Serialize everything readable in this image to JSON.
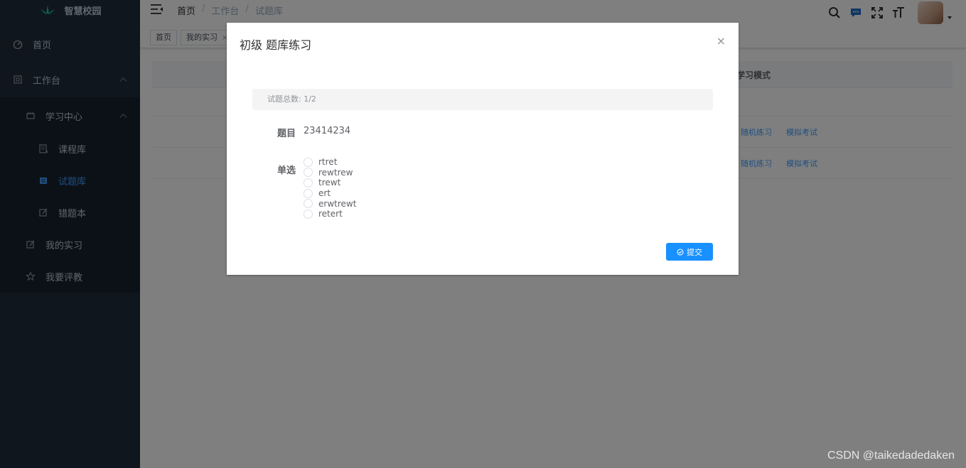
{
  "app": {
    "logo_text": "智慧校园"
  },
  "sidebar": {
    "items": [
      {
        "label": "首页",
        "icon": "dashboard-icon"
      },
      {
        "label": "工作台",
        "icon": "workbench-icon"
      },
      {
        "label": "学习中心",
        "icon": "study-center-icon"
      },
      {
        "label": "课程库",
        "icon": "course-library-icon"
      },
      {
        "label": "试题库",
        "icon": "question-bank-icon"
      },
      {
        "label": "错题本",
        "icon": "mistake-book-icon"
      },
      {
        "label": "我的实习",
        "icon": "internship-icon"
      },
      {
        "label": "我要评教",
        "icon": "star-icon"
      }
    ],
    "active": "试题库"
  },
  "breadcrumb": {
    "items": [
      "首页",
      "工作台",
      "试题库"
    ],
    "separator": "/"
  },
  "tags": [
    {
      "label": "首页"
    },
    {
      "label": "我的实习",
      "close": "×"
    }
  ],
  "table": {
    "header_col": "学习模式",
    "rows": [
      {
        "random": "随机练习",
        "exam": "模拟考试"
      },
      {
        "random": "随机练习",
        "exam": "模拟考试"
      }
    ]
  },
  "dialog": {
    "title": "初级 题库练习",
    "close": "×",
    "total_label": "试题总数: 1/2",
    "question_label": "题目",
    "question_text": "23414234",
    "type_label": "单选",
    "options": [
      "rtret",
      "rewtrew",
      "trewt",
      "ert",
      "erwtrewt",
      "retert"
    ],
    "submit_label": "提交"
  },
  "watermark": "CSDN @taikedadedaken",
  "colors": {
    "sidebar": "#1f2d3d",
    "primary": "#1890ff",
    "active": "#409eff"
  }
}
